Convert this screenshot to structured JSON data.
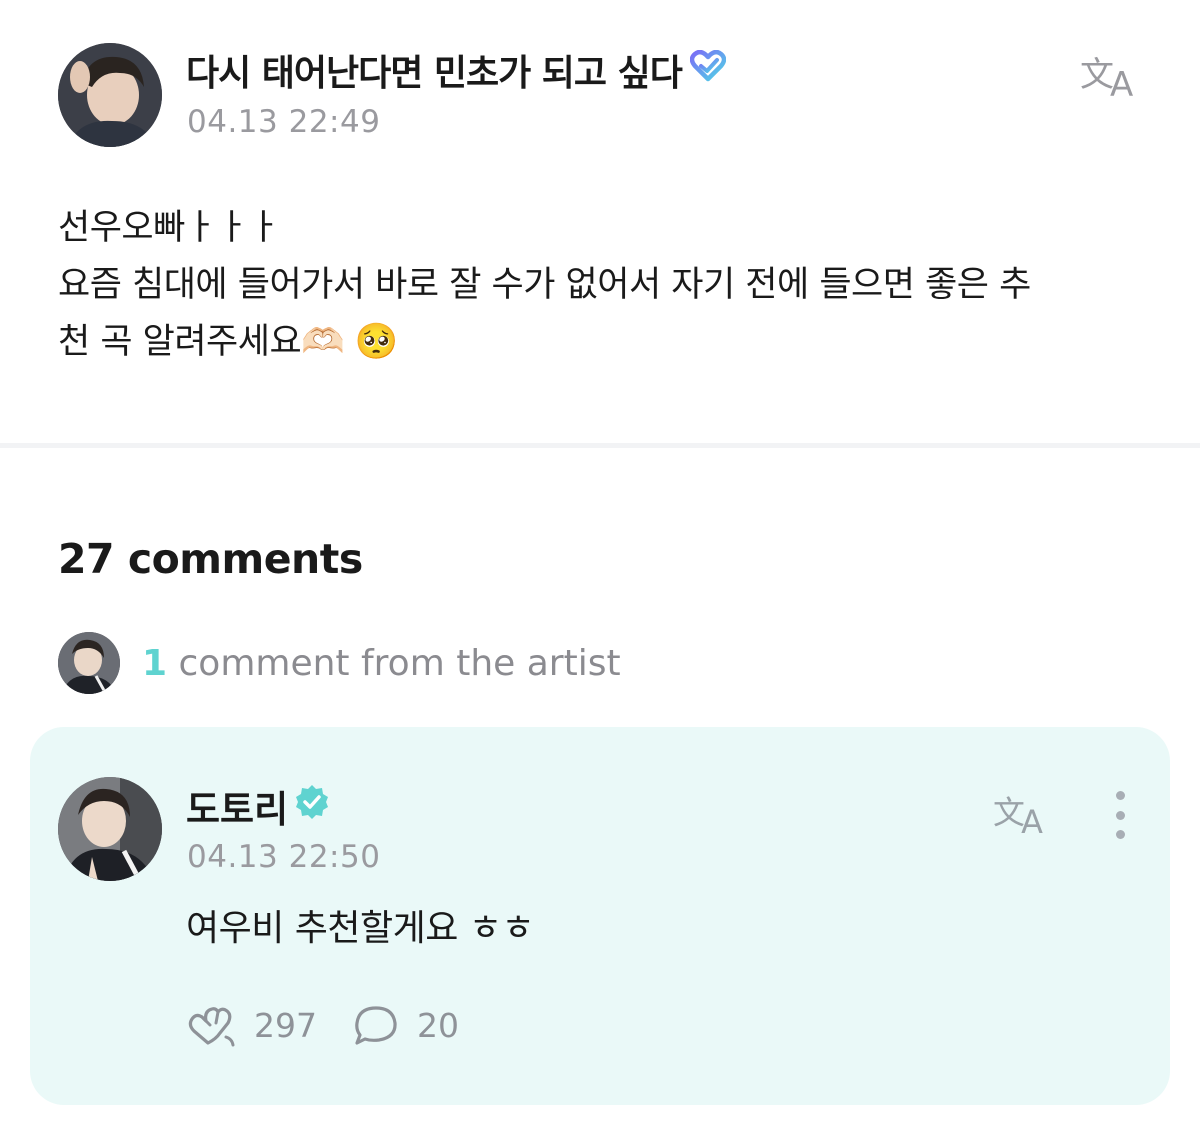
{
  "post": {
    "author": "다시 태어난다면 민초가 되고 싶다",
    "timestamp": "04.13 22:49",
    "body_lines": [
      "선우오빠ㅏㅏㅏ",
      "요즘 침대에 들어가서 바로 잘 수가 없어서  자기 전에 들으면 좋은 추",
      "천 곡 알려주세요🫶🏻 🥺"
    ],
    "author_badge_icon": "heart-badge-icon",
    "translate_icon": "translate-icon"
  },
  "comments": {
    "title": "27 comments",
    "artist_count": "1",
    "artist_label": " comment from the artist"
  },
  "artist_comment": {
    "author": "도토리",
    "verified_icon": "verified-badge-icon",
    "timestamp": "04.13 22:50",
    "text": "여우비 추천할게요 ㅎㅎ",
    "likes": "297",
    "replies": "20",
    "like_icon": "heart-applause-icon",
    "reply_icon": "speech-bubble-icon",
    "more_icon": "more-vertical-icon"
  },
  "colors": {
    "accent_teal": "#5fd3d0",
    "card_background": "#eaf9f8",
    "muted_text": "#9a9a9f",
    "badge_gradient_start": "#7b6cf6",
    "badge_gradient_end": "#4fd6e6"
  }
}
